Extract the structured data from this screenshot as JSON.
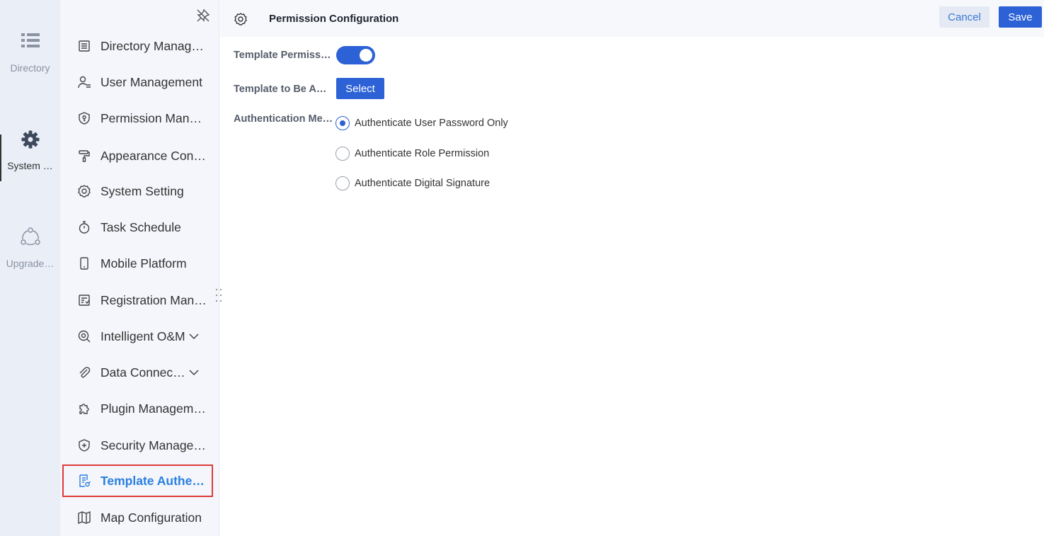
{
  "rail": {
    "items": [
      {
        "label": "Directory",
        "icon": "list-icon"
      },
      {
        "label": "System …",
        "icon": "gear-icon"
      },
      {
        "label": "Upgrade…",
        "icon": "share-nodes-icon"
      }
    ]
  },
  "sidebar": {
    "items": [
      {
        "label": "Directory Manag…",
        "icon": "directory-icon"
      },
      {
        "label": "User Management",
        "icon": "user-icon"
      },
      {
        "label": "Permission Mana…",
        "icon": "shield-key-icon"
      },
      {
        "label": "Appearance Conf…",
        "icon": "paint-roller-icon"
      },
      {
        "label": "System Setting",
        "icon": "settings-icon"
      },
      {
        "label": "Task Schedule",
        "icon": "stopwatch-icon"
      },
      {
        "label": "Mobile Platform",
        "icon": "mobile-icon"
      },
      {
        "label": "Registration Man…",
        "icon": "registration-icon"
      },
      {
        "label": "Intelligent O&M",
        "icon": "monitor-icon",
        "expandable": true
      },
      {
        "label": "Data Connec…",
        "icon": "paperclip-icon",
        "expandable": true
      },
      {
        "label": "Plugin Managem…",
        "icon": "puzzle-icon"
      },
      {
        "label": "Security Manage…",
        "icon": "shield-plus-icon"
      },
      {
        "label": "Template Authe…",
        "icon": "document-edit-icon",
        "selected": true
      },
      {
        "label": "Map Configuration",
        "icon": "map-icon"
      }
    ]
  },
  "header": {
    "title": "Permission Configuration",
    "cancel_label": "Cancel",
    "save_label": "Save"
  },
  "form": {
    "template_permission_label": "Template Permiss…",
    "template_permission_enabled": true,
    "template_to_be_label": "Template to Be A…",
    "select_label": "Select",
    "auth_method_label": "Authentication Me…",
    "auth_options": [
      {
        "label": "Authenticate User Password Only",
        "checked": true
      },
      {
        "label": "Authenticate Role Permission",
        "checked": false
      },
      {
        "label": "Authenticate Digital Signature",
        "checked": false
      }
    ]
  },
  "colors": {
    "accent": "#2c62d6",
    "selected_text": "#2a7fe0",
    "highlight_border": "#e03a3a"
  }
}
